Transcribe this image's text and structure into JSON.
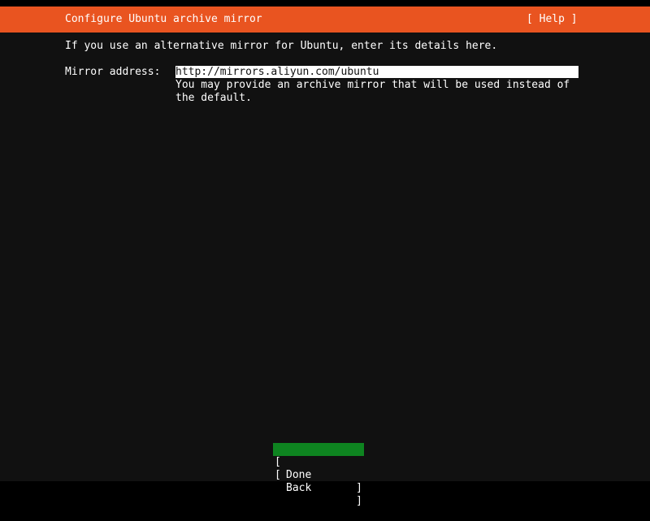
{
  "header": {
    "title": "Configure Ubuntu archive mirror",
    "help_label": "[ Help ]",
    "background_color": "#e95420"
  },
  "main": {
    "intro": "If you use an alternative mirror for Ubuntu, enter its details here.",
    "mirror_label": "Mirror address:",
    "mirror_value": "http://mirrors.aliyun.com/ubuntu",
    "help_line1": "You may provide an archive mirror that will be used instead of",
    "help_line2": "the default."
  },
  "buttons": {
    "done_label": "Done",
    "back_label": "Back",
    "open_bracket": "[",
    "close_bracket": "]",
    "focused_color": "#0e8420"
  }
}
